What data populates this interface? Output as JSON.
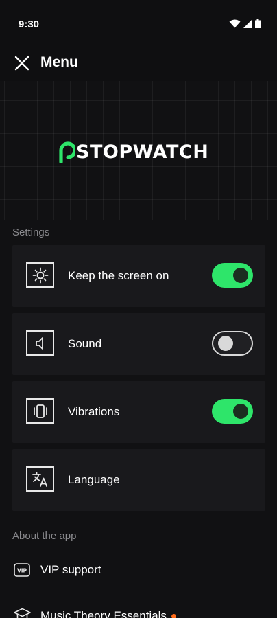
{
  "status_bar": {
    "time": "9:30"
  },
  "header": {
    "title": "Menu",
    "close_icon": "close-icon"
  },
  "hero": {
    "logo_text": "STOPWATCH",
    "accent_color": "#2ee56a"
  },
  "settings": {
    "section_label": "Settings",
    "items": [
      {
        "label": "Keep the screen on",
        "icon": "brightness-icon",
        "toggle": true
      },
      {
        "label": "Sound",
        "icon": "speaker-icon",
        "toggle": false
      },
      {
        "label": "Vibrations",
        "icon": "vibration-icon",
        "toggle": true
      },
      {
        "label": "Language",
        "icon": "translate-icon"
      }
    ]
  },
  "about": {
    "section_label": "About the app",
    "items": [
      {
        "label": "VIP support",
        "icon": "vip-icon"
      },
      {
        "label": "Music Theory Essentials",
        "icon": "graduation-cap-icon",
        "badge_color": "#ff6b1a"
      }
    ]
  }
}
